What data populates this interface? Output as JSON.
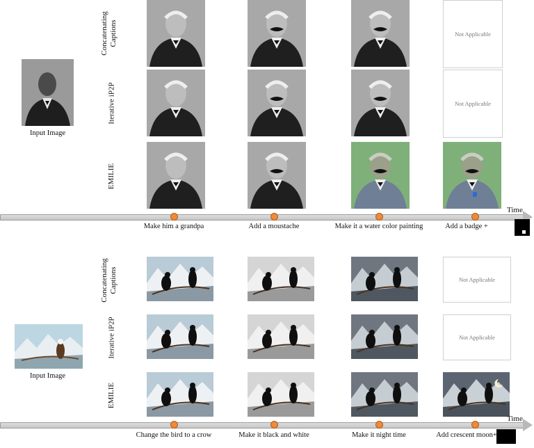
{
  "rows": {
    "concat": "Concatenating Captions",
    "iterative": "Iterative iP2P",
    "emilie": "EMILIE"
  },
  "input_label": "Input Image",
  "not_applicable": "Not Applicable",
  "time_label": "Time",
  "panel1": {
    "steps": [
      "Make him a grandpa",
      "Add a moustache",
      "Make it a water color painting",
      "Add a badge +"
    ]
  },
  "panel2": {
    "steps": [
      "Change the bird to a crow",
      "Make it black and white",
      "Make it night time",
      "Add crescent moon+"
    ]
  },
  "colors": {
    "dot": "#ee8a3a",
    "timeline": "#c9c9c9"
  },
  "icons": [
    "portrait-image",
    "crow-image",
    "mask-image",
    "arrow-icon"
  ]
}
